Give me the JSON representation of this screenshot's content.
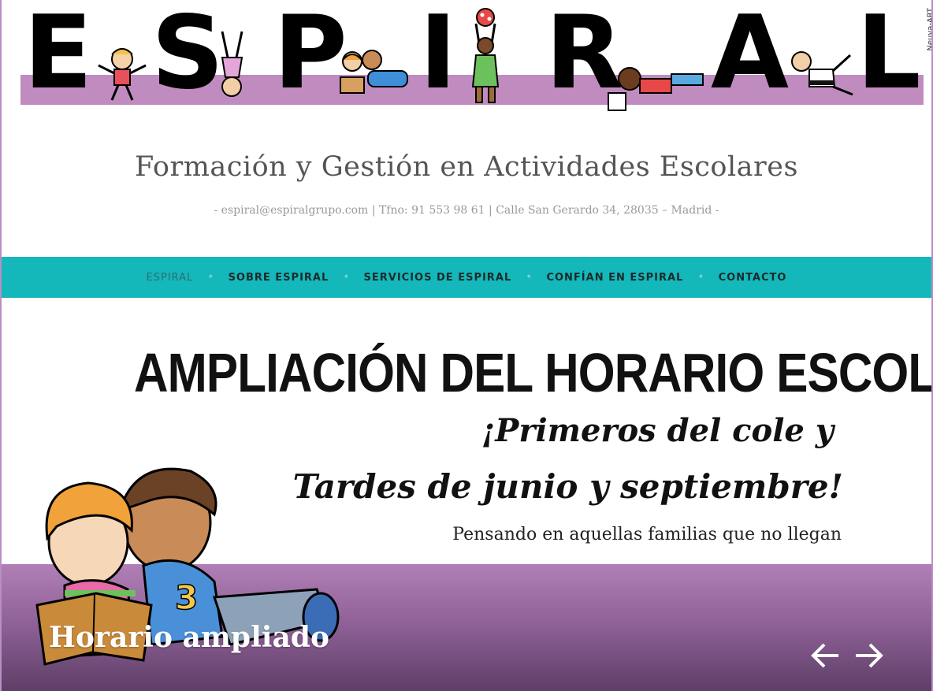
{
  "banner": {
    "letters": [
      "E",
      "S",
      "P",
      "I",
      "R",
      "A",
      "L"
    ],
    "signature": "Neuya-ART"
  },
  "site": {
    "tagline": "Formación y Gestión en Actividades Escolares",
    "contact_line": "- espiral@espiralgrupo.com | Tfno: 91 553 98 61 | Calle San Gerardo 34, 28035 – Madrid -"
  },
  "nav": {
    "items": [
      {
        "label": "ESPIRAL"
      },
      {
        "label": "SOBRE ESPIRAL"
      },
      {
        "label": "SERVICIOS DE ESPIRAL"
      },
      {
        "label": "CONFÍAN EN ESPIRAL"
      },
      {
        "label": "CONTACTO"
      }
    ]
  },
  "slide": {
    "headline": "AMPLIACIÓN DEL HORARIO ESCOLAR",
    "sub1": "¡Primeros del cole y",
    "sub2": "Tardes de junio y septiembre!",
    "sub3": "Pensando en aquellas familias que no llegan",
    "caption": "Horario ampliado",
    "prev_icon": "arrow-left-icon",
    "next_icon": "arrow-right-icon"
  },
  "colors": {
    "accent": "#14b8bb",
    "purple": "#c08cc0",
    "frame": "#b98ec4"
  }
}
